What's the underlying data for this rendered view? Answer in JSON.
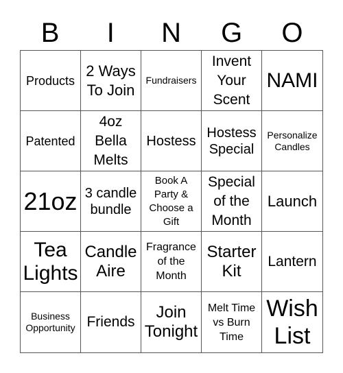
{
  "header": [
    "B",
    "I",
    "N",
    "G",
    "O"
  ],
  "cells": [
    {
      "text": "Products",
      "size": "s18"
    },
    {
      "text": "2 Ways To Join",
      "size": "s22"
    },
    {
      "text": "Fundraisers",
      "size": "s14"
    },
    {
      "text": "Invent Your Scent",
      "size": "s21"
    },
    {
      "text": "NAMI",
      "size": "s30"
    },
    {
      "text": "Patented",
      "size": "s18"
    },
    {
      "text": "4oz Bella Melts",
      "size": "s21"
    },
    {
      "text": "Hostess",
      "size": "s20"
    },
    {
      "text": "Hostess Special",
      "size": "s20"
    },
    {
      "text": "Personalize Candles",
      "size": "s14"
    },
    {
      "text": "21oz",
      "size": "s36"
    },
    {
      "text": "3 candle bundle",
      "size": "s20"
    },
    {
      "text": "Book A Party & Choose a Gift",
      "size": "s15"
    },
    {
      "text": "Special of the Month",
      "size": "s21"
    },
    {
      "text": "Launch",
      "size": "s22"
    },
    {
      "text": "Tea Lights",
      "size": "s30"
    },
    {
      "text": "Candle Aire",
      "size": "s24"
    },
    {
      "text": "Fragrance of the Month",
      "size": "s16"
    },
    {
      "text": "Starter Kit",
      "size": "s24"
    },
    {
      "text": "Lantern",
      "size": "s21"
    },
    {
      "text": "Business Opportunity",
      "size": "s14"
    },
    {
      "text": "Friends",
      "size": "s21"
    },
    {
      "text": "Join Tonight",
      "size": "s24"
    },
    {
      "text": "Melt Time vs Burn Time",
      "size": "s16"
    },
    {
      "text": "Wish List",
      "size": "s34"
    }
  ]
}
